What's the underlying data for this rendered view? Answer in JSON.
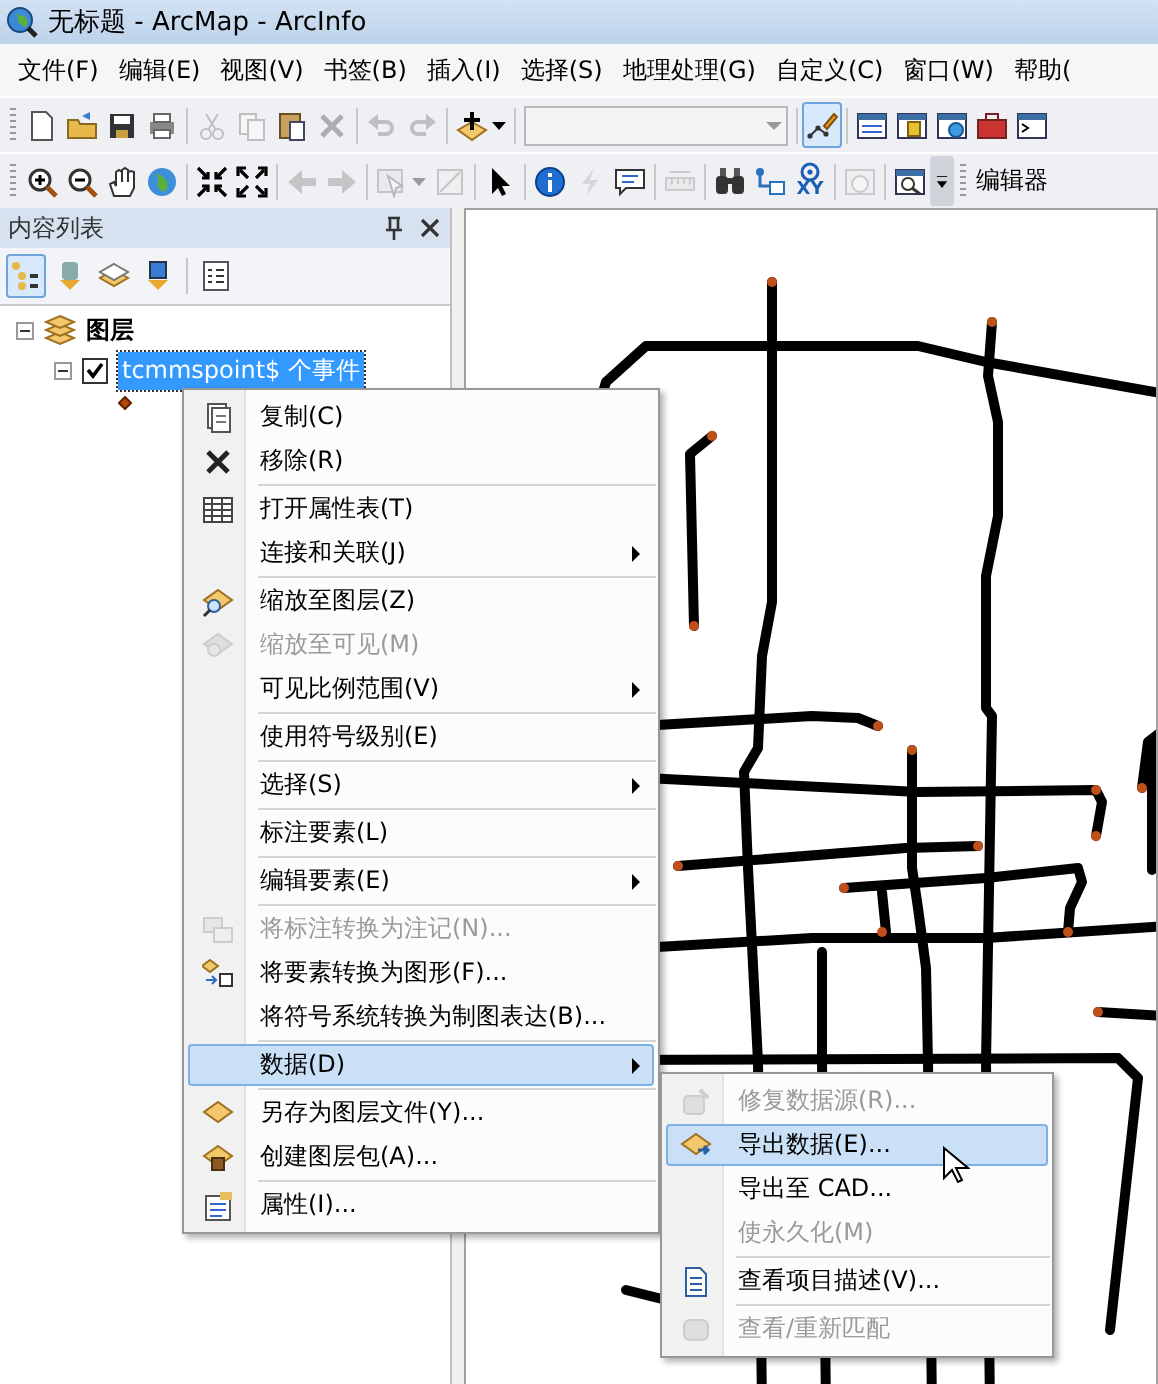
{
  "window": {
    "title": "无标题 - ArcMap - ArcInfo"
  },
  "menu_bar": [
    "文件(F)",
    "编辑(E)",
    "视图(V)",
    "书签(B)",
    "插入(I)",
    "选择(S)",
    "地理处理(G)",
    "自定义(C)",
    "窗口(W)",
    "帮助("
  ],
  "toolbars": [
    {
      "groups": [
        [
          {
            "kind": "new",
            "disabled": false,
            "pressed": false
          },
          {
            "kind": "open",
            "disabled": false,
            "pressed": false
          },
          {
            "kind": "save",
            "disabled": false,
            "pressed": false
          },
          {
            "kind": "print",
            "disabled": false,
            "pressed": false
          }
        ],
        [
          {
            "kind": "cut",
            "disabled": true,
            "pressed": false
          },
          {
            "kind": "copy",
            "disabled": true,
            "pressed": false
          },
          {
            "kind": "paste",
            "disabled": false,
            "pressed": false
          },
          {
            "kind": "delete",
            "disabled": true,
            "pressed": false
          }
        ],
        [
          {
            "kind": "undo",
            "disabled": true,
            "pressed": false
          },
          {
            "kind": "redo",
            "disabled": true,
            "pressed": false
          }
        ],
        [
          {
            "kind": "add_data",
            "disabled": false,
            "pressed": false
          }
        ],
        [
          {
            "kind": "combo",
            "disabled": false,
            "pressed": false
          }
        ],
        [
          {
            "kind": "editor",
            "disabled": false,
            "pressed": true
          }
        ],
        [
          {
            "kind": "table",
            "disabled": false,
            "pressed": false
          },
          {
            "kind": "catalog",
            "disabled": false,
            "pressed": false
          },
          {
            "kind": "search_window",
            "disabled": false,
            "pressed": false
          },
          {
            "kind": "toolbox",
            "disabled": false,
            "pressed": false
          },
          {
            "kind": "python",
            "disabled": false,
            "pressed": false
          }
        ]
      ]
    },
    {
      "groups": [
        [
          {
            "kind": "zoom_in",
            "disabled": false,
            "pressed": false
          },
          {
            "kind": "zoom_out",
            "disabled": false,
            "pressed": false
          },
          {
            "kind": "pan",
            "disabled": false,
            "pressed": false
          },
          {
            "kind": "globe",
            "disabled": false,
            "pressed": false
          }
        ],
        [
          {
            "kind": "fixed_in",
            "disabled": false,
            "pressed": false
          },
          {
            "kind": "fixed_out",
            "disabled": false,
            "pressed": false
          }
        ],
        [
          {
            "kind": "back",
            "disabled": true,
            "pressed": false
          },
          {
            "kind": "forward",
            "disabled": true,
            "pressed": false
          }
        ],
        [
          {
            "kind": "select_features",
            "disabled": true,
            "pressed": false
          },
          {
            "kind": "clear_selection",
            "disabled": true,
            "pressed": false
          }
        ],
        [
          {
            "kind": "pointer",
            "disabled": false,
            "pressed": false
          }
        ],
        [
          {
            "kind": "identify",
            "disabled": false,
            "pressed": false
          },
          {
            "kind": "hyperlink",
            "disabled": true,
            "pressed": false
          },
          {
            "kind": "html_popup",
            "disabled": false,
            "pressed": false
          }
        ],
        [
          {
            "kind": "measure",
            "disabled": true,
            "pressed": false
          }
        ],
        [
          {
            "kind": "find",
            "disabled": false,
            "pressed": false
          },
          {
            "kind": "route",
            "disabled": false,
            "pressed": false
          },
          {
            "kind": "goto_xy",
            "disabled": false,
            "pressed": false,
            "text": "XY"
          }
        ],
        [
          {
            "kind": "time_slider",
            "disabled": true,
            "pressed": false
          }
        ],
        [
          {
            "kind": "magnifier",
            "disabled": false,
            "pressed": false
          },
          {
            "kind": "more",
            "disabled": false,
            "pressed": false
          }
        ]
      ],
      "label": "编辑器"
    }
  ],
  "toc": {
    "title": "内容列表",
    "tools": [
      [
        {
          "kind": "drawing_order",
          "selected": true
        },
        {
          "kind": "source",
          "selected": false
        },
        {
          "kind": "visibility",
          "selected": false
        },
        {
          "kind": "selection",
          "selected": false
        }
      ],
      [
        {
          "kind": "options",
          "selected": false
        }
      ]
    ],
    "tree": [
      {
        "kind": "group",
        "label": "图层",
        "expanded": true,
        "children": [
          {
            "kind": "layer",
            "label": "tcmmspoint$ 个事件",
            "expanded": true,
            "checked": true,
            "selected": true
          }
        ]
      }
    ]
  },
  "context_menu": {
    "groups": [
      [
        {
          "label": "复制(C)",
          "kind": "copy",
          "disabled": false,
          "submenu": false,
          "selected": false
        },
        {
          "label": "移除(R)",
          "kind": "remove",
          "disabled": false,
          "submenu": false,
          "selected": false
        }
      ],
      [
        {
          "label": "打开属性表(T)",
          "kind": "table",
          "disabled": false,
          "submenu": false,
          "selected": false
        },
        {
          "label": "连接和关联(J)",
          "kind": "plain",
          "disabled": false,
          "submenu": true,
          "selected": false
        }
      ],
      [
        {
          "label": "缩放至图层(Z)",
          "kind": "zoom_layer",
          "disabled": false,
          "submenu": false,
          "selected": false
        },
        {
          "label": "缩放至可见(M)",
          "kind": "zoom_visible",
          "disabled": true,
          "submenu": false,
          "selected": false
        },
        {
          "label": "可见比例范围(V)",
          "kind": "plain",
          "disabled": false,
          "submenu": true,
          "selected": false
        }
      ],
      [
        {
          "label": "使用符号级别(E)",
          "kind": "plain",
          "disabled": false,
          "submenu": false,
          "selected": false
        }
      ],
      [
        {
          "label": "选择(S)",
          "kind": "plain",
          "disabled": false,
          "submenu": true,
          "selected": false
        }
      ],
      [
        {
          "label": "标注要素(L)",
          "kind": "plain",
          "disabled": false,
          "submenu": false,
          "selected": false
        }
      ],
      [
        {
          "label": "编辑要素(E)",
          "kind": "plain",
          "disabled": false,
          "submenu": true,
          "selected": false
        }
      ],
      [
        {
          "label": "将标注转换为注记(N)...",
          "kind": "convert_labels",
          "disabled": true,
          "submenu": false,
          "selected": false
        },
        {
          "label": "将要素转换为图形(F)...",
          "kind": "to_graphics",
          "disabled": false,
          "submenu": false,
          "selected": false
        },
        {
          "label": "将符号系统转换为制图表达(B)...",
          "kind": "plain",
          "disabled": false,
          "submenu": false,
          "selected": false
        }
      ],
      [
        {
          "label": "数据(D)",
          "kind": "plain",
          "disabled": false,
          "submenu": true,
          "selected": true
        }
      ],
      [
        {
          "label": "另存为图层文件(Y)...",
          "kind": "save_layer",
          "disabled": false,
          "submenu": false,
          "selected": false
        },
        {
          "label": "创建图层包(A)...",
          "kind": "package",
          "disabled": false,
          "submenu": false,
          "selected": false
        }
      ],
      [
        {
          "label": "属性(I)...",
          "kind": "properties",
          "disabled": false,
          "submenu": false,
          "selected": false
        }
      ]
    ]
  },
  "submenu": {
    "groups": [
      [
        {
          "label": "修复数据源(R)...",
          "kind": "repair",
          "disabled": true,
          "submenu": false,
          "selected": false
        },
        {
          "label": "导出数据(E)...",
          "kind": "export",
          "disabled": false,
          "submenu": false,
          "selected": true
        },
        {
          "label": "导出至 CAD...",
          "kind": "plain",
          "disabled": false,
          "submenu": false,
          "selected": false
        },
        {
          "label": "使永久化(M)",
          "kind": "plain",
          "disabled": true,
          "submenu": false,
          "selected": false
        }
      ],
      [
        {
          "label": "查看项目描述(V)...",
          "kind": "describe",
          "disabled": false,
          "submenu": false,
          "selected": false
        }
      ],
      [
        {
          "label": "查看/重新匹配",
          "kind": "rematch",
          "disabled": true,
          "submenu": false,
          "selected": false
        }
      ]
    ]
  }
}
